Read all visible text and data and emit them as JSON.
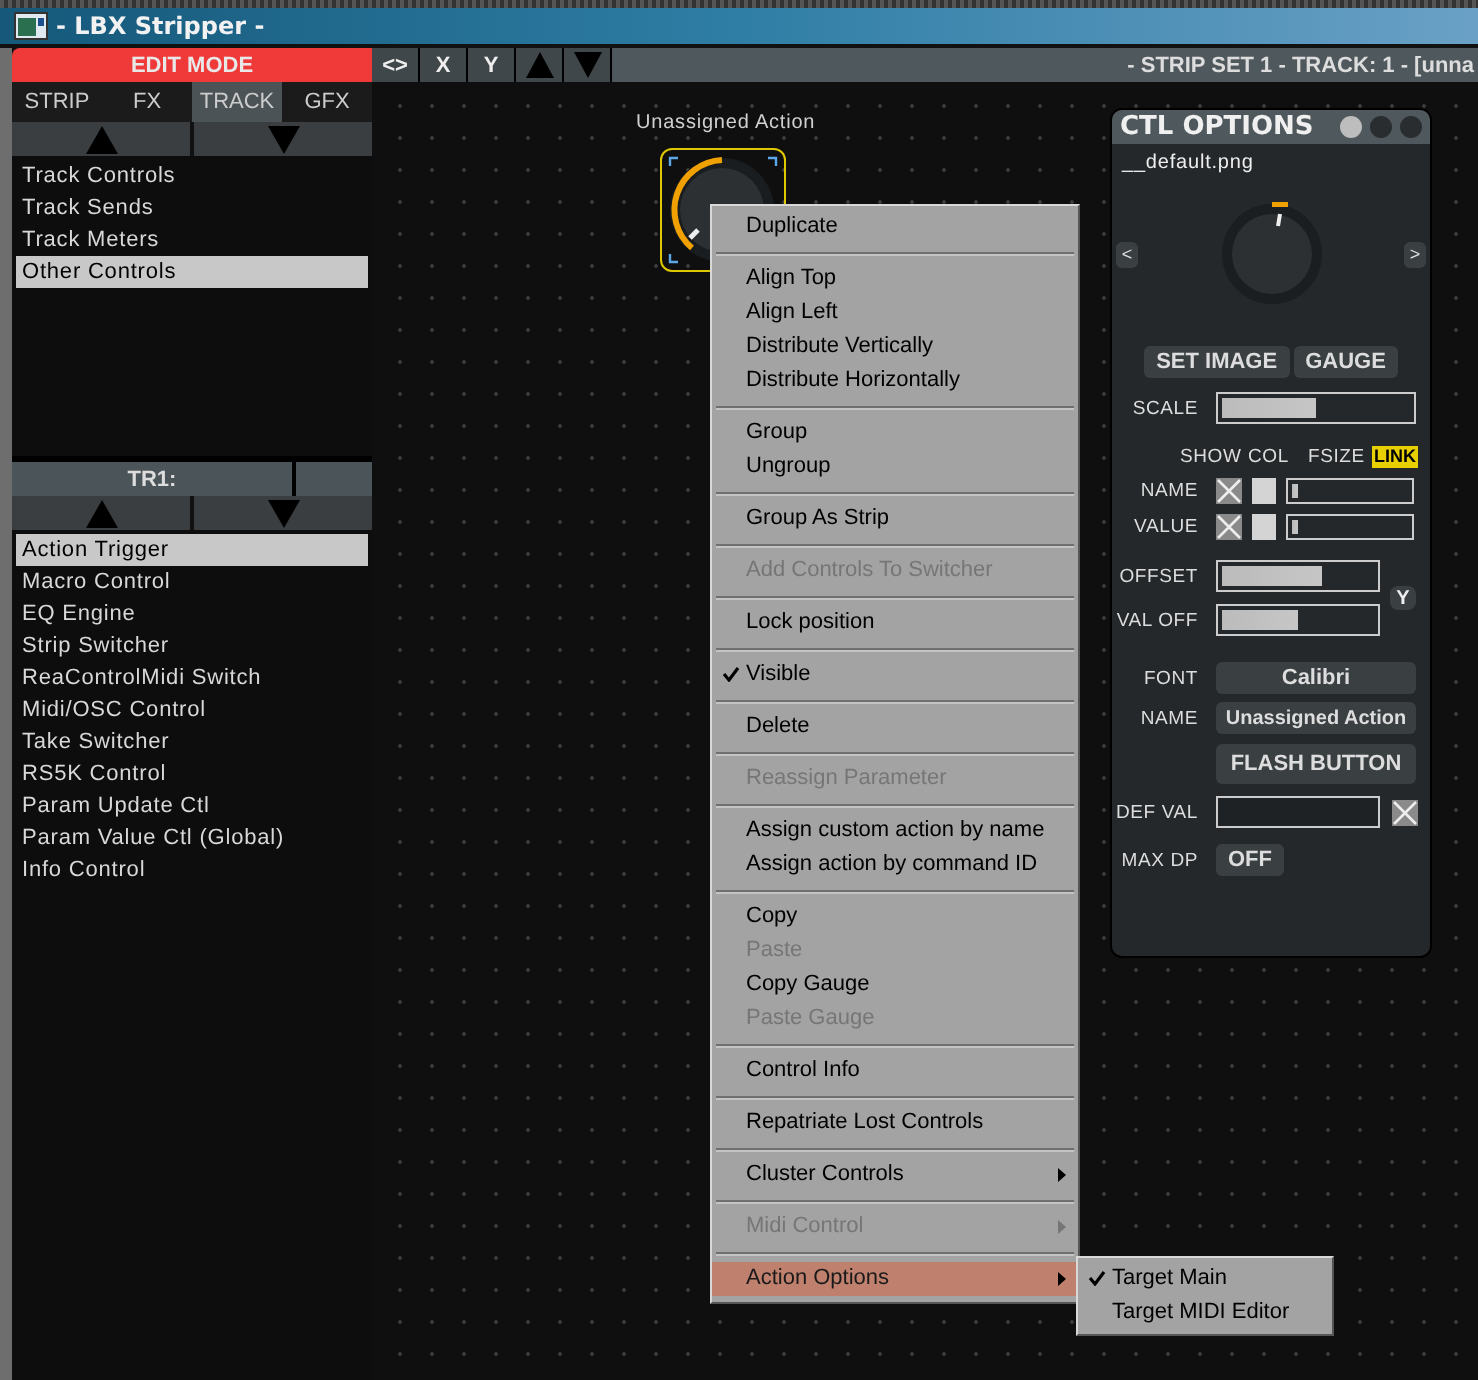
{
  "window": {
    "title": "- LBX Stripper -"
  },
  "sidebar": {
    "mode_banner": "EDIT MODE",
    "tabs": [
      {
        "label": "STRIP",
        "selected": false
      },
      {
        "label": "FX",
        "selected": false
      },
      {
        "label": "TRACK",
        "selected": true
      },
      {
        "label": "GFX",
        "selected": false
      }
    ],
    "upper_list": {
      "items": [
        {
          "label": "Track Controls",
          "selected": false
        },
        {
          "label": "Track Sends",
          "selected": false
        },
        {
          "label": "Track Meters",
          "selected": false
        },
        {
          "label": "Other Controls",
          "selected": true
        }
      ]
    },
    "lower_header": {
      "title": "TR1:"
    },
    "lower_list": {
      "items": [
        {
          "label": "Action Trigger",
          "selected": true
        },
        {
          "label": "Macro Control",
          "selected": false
        },
        {
          "label": "EQ Engine",
          "selected": false
        },
        {
          "label": "Strip Switcher",
          "selected": false
        },
        {
          "label": "ReaControlMidi Switch",
          "selected": false
        },
        {
          "label": "Midi/OSC Control",
          "selected": false
        },
        {
          "label": "Take Switcher",
          "selected": false
        },
        {
          "label": "RS5K Control",
          "selected": false
        },
        {
          "label": "Param Update Ctl",
          "selected": false
        },
        {
          "label": "Param Value Ctl (Global)",
          "selected": false
        },
        {
          "label": "Info Control",
          "selected": false
        }
      ]
    }
  },
  "toolbar": {
    "buttons": [
      {
        "kind": "text",
        "label": "<>"
      },
      {
        "kind": "text",
        "label": "X"
      },
      {
        "kind": "text",
        "label": "Y"
      },
      {
        "kind": "up"
      },
      {
        "kind": "down"
      }
    ],
    "info": "- STRIP SET 1 - TRACK: 1 - [unna"
  },
  "canvas": {
    "control": {
      "label": "Unassigned Action",
      "selected": true
    }
  },
  "context_menu": {
    "items": [
      {
        "kind": "item",
        "label": "Duplicate",
        "checked": false,
        "disabled": false,
        "submenu": false,
        "selected": false
      },
      {
        "kind": "separator"
      },
      {
        "kind": "item",
        "label": "Align Top",
        "checked": false,
        "disabled": false,
        "submenu": false,
        "selected": false
      },
      {
        "kind": "item",
        "label": "Align Left",
        "checked": false,
        "disabled": false,
        "submenu": false,
        "selected": false
      },
      {
        "kind": "item",
        "label": "Distribute Vertically",
        "checked": false,
        "disabled": false,
        "submenu": false,
        "selected": false
      },
      {
        "kind": "item",
        "label": "Distribute Horizontally",
        "checked": false,
        "disabled": false,
        "submenu": false,
        "selected": false
      },
      {
        "kind": "separator"
      },
      {
        "kind": "item",
        "label": "Group",
        "checked": false,
        "disabled": false,
        "submenu": false,
        "selected": false
      },
      {
        "kind": "item",
        "label": "Ungroup",
        "checked": false,
        "disabled": false,
        "submenu": false,
        "selected": false
      },
      {
        "kind": "separator"
      },
      {
        "kind": "item",
        "label": "Group As Strip",
        "checked": false,
        "disabled": false,
        "submenu": false,
        "selected": false
      },
      {
        "kind": "separator"
      },
      {
        "kind": "item",
        "label": "Add Controls To Switcher",
        "checked": false,
        "disabled": true,
        "submenu": false,
        "selected": false
      },
      {
        "kind": "separator"
      },
      {
        "kind": "item",
        "label": "Lock position",
        "checked": false,
        "disabled": false,
        "submenu": false,
        "selected": false
      },
      {
        "kind": "separator"
      },
      {
        "kind": "item",
        "label": "Visible",
        "checked": true,
        "disabled": false,
        "submenu": false,
        "selected": false
      },
      {
        "kind": "separator"
      },
      {
        "kind": "item",
        "label": "Delete",
        "checked": false,
        "disabled": false,
        "submenu": false,
        "selected": false
      },
      {
        "kind": "separator"
      },
      {
        "kind": "item",
        "label": "Reassign Parameter",
        "checked": false,
        "disabled": true,
        "submenu": false,
        "selected": false
      },
      {
        "kind": "separator"
      },
      {
        "kind": "item",
        "label": "Assign custom action by name",
        "checked": false,
        "disabled": false,
        "submenu": false,
        "selected": false
      },
      {
        "kind": "item",
        "label": "Assign action by command ID",
        "checked": false,
        "disabled": false,
        "submenu": false,
        "selected": false
      },
      {
        "kind": "separator"
      },
      {
        "kind": "item",
        "label": "Copy",
        "checked": false,
        "disabled": false,
        "submenu": false,
        "selected": false
      },
      {
        "kind": "item",
        "label": "Paste",
        "checked": false,
        "disabled": true,
        "submenu": false,
        "selected": false
      },
      {
        "kind": "item",
        "label": "Copy Gauge",
        "checked": false,
        "disabled": false,
        "submenu": false,
        "selected": false
      },
      {
        "kind": "item",
        "label": "Paste Gauge",
        "checked": false,
        "disabled": true,
        "submenu": false,
        "selected": false
      },
      {
        "kind": "separator"
      },
      {
        "kind": "item",
        "label": "Control Info",
        "checked": false,
        "disabled": false,
        "submenu": false,
        "selected": false
      },
      {
        "kind": "separator"
      },
      {
        "kind": "item",
        "label": "Repatriate Lost Controls",
        "checked": false,
        "disabled": false,
        "submenu": false,
        "selected": false
      },
      {
        "kind": "separator"
      },
      {
        "kind": "item",
        "label": "Cluster Controls",
        "checked": false,
        "disabled": false,
        "submenu": true,
        "selected": false
      },
      {
        "kind": "separator"
      },
      {
        "kind": "item",
        "label": "Midi Control",
        "checked": false,
        "disabled": true,
        "submenu": true,
        "selected": false
      },
      {
        "kind": "separator"
      },
      {
        "kind": "item",
        "label": "Action Options",
        "checked": false,
        "disabled": false,
        "submenu": true,
        "selected": true
      }
    ],
    "submenu": {
      "items": [
        {
          "label": "Target Main",
          "checked": true
        },
        {
          "label": "Target MIDI Editor",
          "checked": false
        }
      ]
    }
  },
  "ctl_options": {
    "title": "CTL OPTIONS",
    "image_file": "__default.png",
    "prev": "<",
    "next": ">",
    "buttons": [
      "SET IMAGE",
      "GAUGE"
    ],
    "scale": {
      "label": "SCALE",
      "level": 0.5
    },
    "columns": [
      "SHOW",
      "COL",
      "FSIZE"
    ],
    "link": {
      "label": "LINK",
      "on": true
    },
    "text_rows": [
      {
        "label": "NAME",
        "show": true,
        "level": 0.06
      },
      {
        "label": "VALUE",
        "show": true,
        "level": 0.06
      }
    ],
    "offset": {
      "label": "OFFSET",
      "level": 0.66
    },
    "valoff": {
      "label": "VAL OFF",
      "level": 0.5
    },
    "axis_button": "Y",
    "font": {
      "label": "FONT",
      "value": "Calibri"
    },
    "name": {
      "label": "NAME",
      "value": "Unassigned Action"
    },
    "flash_button": "FLASH BUTTON",
    "def_val": {
      "label": "DEF VAL",
      "checked": true
    },
    "max_dp": {
      "label": "MAX DP",
      "value": "OFF"
    }
  }
}
